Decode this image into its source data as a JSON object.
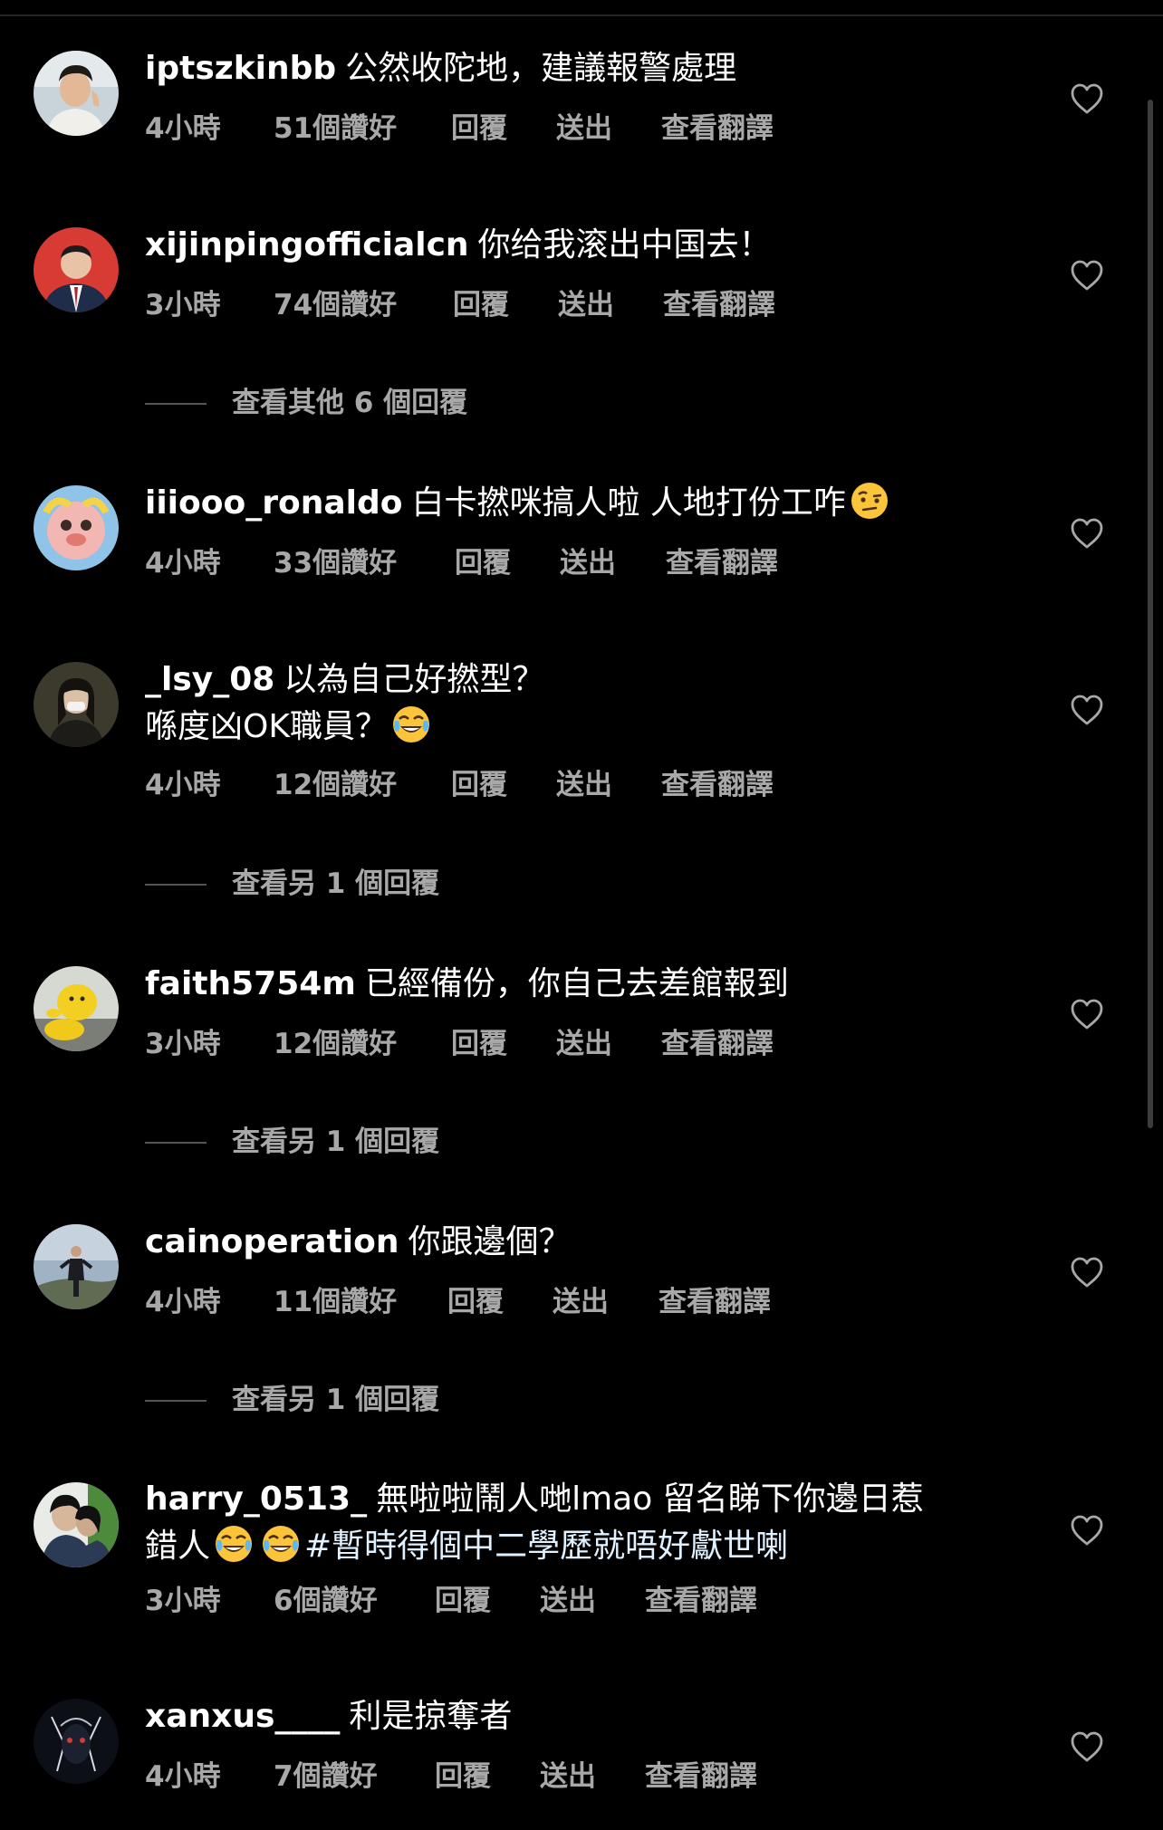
{
  "comments": [
    {
      "username": "iptszkinbb",
      "text_line1": "公然收陀地，建議報警處理",
      "time": "4小時",
      "likes": "51個讚好",
      "reply_label": "回覆",
      "send_label": "送出",
      "translate_label": "查看翻譯",
      "avatar_icon": "avatar-photo"
    },
    {
      "username": "xijinpingofficialcn",
      "text_line1": "你给我滚出中国去！",
      "time": "3小時",
      "likes": "74個讚好",
      "reply_label": "回覆",
      "send_label": "送出",
      "translate_label": "查看翻譯",
      "avatar_icon": "avatar-photo",
      "view_replies": "查看其他 6 個回覆"
    },
    {
      "username": "iiiooo_ronaldo",
      "text_line1": "白卡撚咪搞人啦 人地打份工咋",
      "emoji_1": "raised-eyebrow-emoji",
      "time": "4小時",
      "likes": "33個讚好",
      "reply_label": "回覆",
      "send_label": "送出",
      "translate_label": "查看翻譯",
      "avatar_icon": "avatar-photo"
    },
    {
      "username": "_lsy_08",
      "text_line1": "以為自己好撚型？",
      "text_line2": "喺度凶OK職員？",
      "emoji_1": "tears-of-joy-emoji",
      "time": "4小時",
      "likes": "12個讚好",
      "reply_label": "回覆",
      "send_label": "送出",
      "translate_label": "查看翻譯",
      "avatar_icon": "avatar-photo",
      "view_replies": "查看另 1 個回覆"
    },
    {
      "username": "faith5754m",
      "text_line1": "已經備份，你自己去差館報到",
      "time": "3小時",
      "likes": "12個讚好",
      "reply_label": "回覆",
      "send_label": "送出",
      "translate_label": "查看翻譯",
      "avatar_icon": "avatar-photo",
      "view_replies": "查看另 1 個回覆"
    },
    {
      "username": "cainoperation",
      "text_line1": "你跟邊個？",
      "time": "4小時",
      "likes": "11個讚好",
      "reply_label": "回覆",
      "send_label": "送出",
      "translate_label": "查看翻譯",
      "avatar_icon": "avatar-photo",
      "view_replies": "查看另 1 個回覆"
    },
    {
      "username": "harry_0513_",
      "text_line1": "無啦啦鬧人哋lmao 留名睇下你邊日惹",
      "text_line2_prefix": "錯人",
      "hashtag": "#暫時得個中二學歷就唔好獻世喇",
      "emoji_1": "tears-of-joy-emoji",
      "emoji_2": "tears-of-joy-emoji",
      "time": "3小時",
      "likes": "6個讚好",
      "reply_label": "回覆",
      "send_label": "送出",
      "translate_label": "查看翻譯",
      "avatar_icon": "avatar-photo"
    },
    {
      "username": "xanxus____",
      "text_line1": "利是掠奪者",
      "time": "4小時",
      "likes": "7個讚好",
      "reply_label": "回覆",
      "send_label": "送出",
      "translate_label": "查看翻譯",
      "avatar_icon": "avatar-photo"
    }
  ],
  "like_icon": "heart-outline-icon",
  "colors": {
    "background": "#000000",
    "primary_text": "#ffffff",
    "secondary_text": "#a8a8a8",
    "hashtag": "#e0f1ff"
  }
}
